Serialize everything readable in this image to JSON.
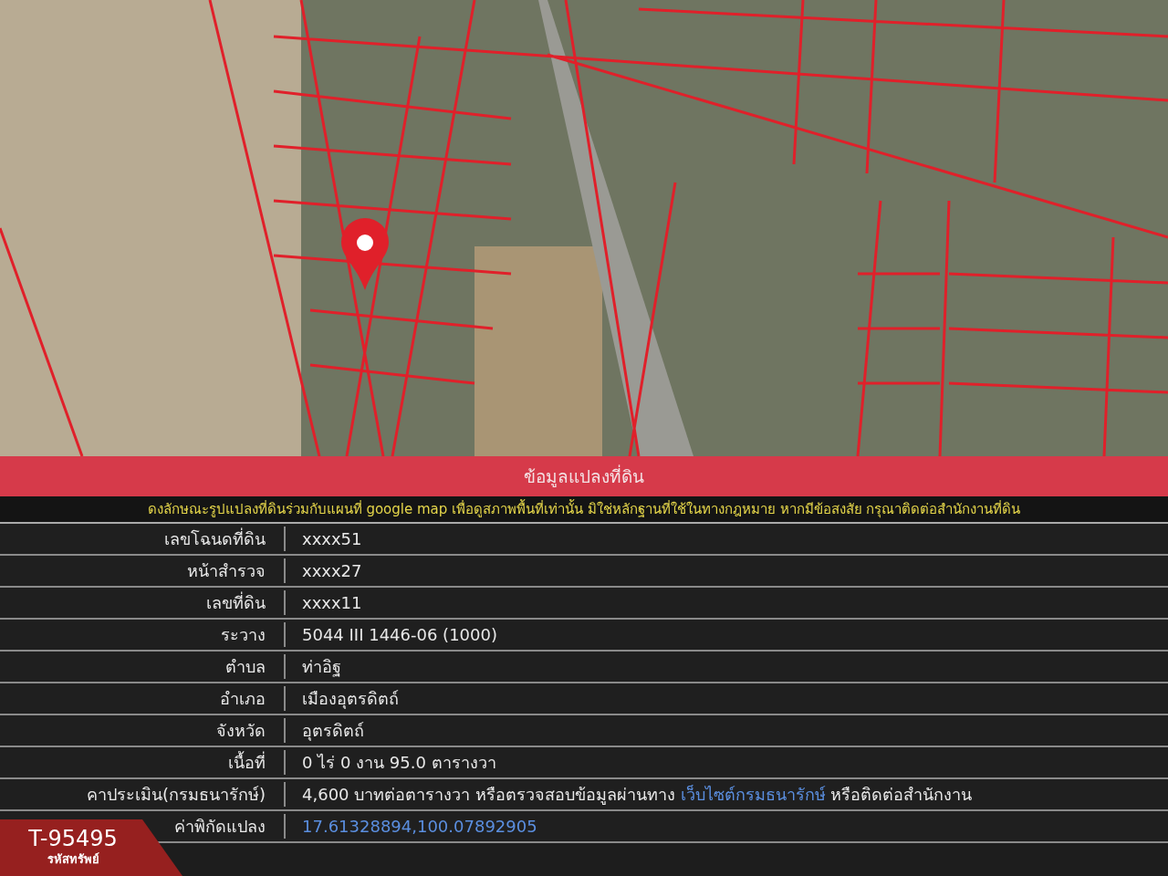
{
  "panel_title": "ข้อมูลแปลงที่ดิน",
  "notice": "ดงลักษณะรูปแปลงที่ดินร่วมกับแผนที่ google map เพื่อดูสภาพพื้นที่เท่านั้น มิใช่หลักฐานที่ใช้ในทางกฎหมาย หากมีข้อสงสัย กรุณาติดต่อสำนักงานที่ดิน",
  "rows": [
    {
      "kind": "text",
      "label": "เลขโฉนดที่ดิน",
      "value": "xxxx51"
    },
    {
      "kind": "text",
      "label": "หน้าสำรวจ",
      "value": "xxxx27"
    },
    {
      "kind": "text",
      "label": "เลขที่ดิน",
      "value": "xxxx11"
    },
    {
      "kind": "text",
      "label": "ระวาง",
      "value": "5044 III 1446-06 (1000)"
    },
    {
      "kind": "text",
      "label": "ตำบล",
      "value": "ท่าอิฐ"
    },
    {
      "kind": "text",
      "label": "อำเภอ",
      "value": "เมืองอุตรดิตถ์"
    },
    {
      "kind": "text",
      "label": "จังหวัด",
      "value": "อุตรดิตถ์"
    },
    {
      "kind": "text",
      "label": "เนื้อที่",
      "value": "0 ไร่ 0 งาน 95.0 ตารางวา"
    },
    {
      "kind": "mixed",
      "label": "คาประเมิน(กรมธนารักษ์)",
      "value": "4,600 บาทต่อตารางวา หรือตรวจสอบข้อมูลผ่านทาง",
      "link": "เว็บไซต์กรมธนารักษ์",
      "value_after": "หรือติดต่อสำนักงาน"
    },
    {
      "kind": "link",
      "label": "ค่าพิกัดแปลง",
      "value": "17.61328894,100.07892905"
    }
  ],
  "asset_tag": {
    "code": "T-95495",
    "label": "รหัสทรัพย์"
  }
}
